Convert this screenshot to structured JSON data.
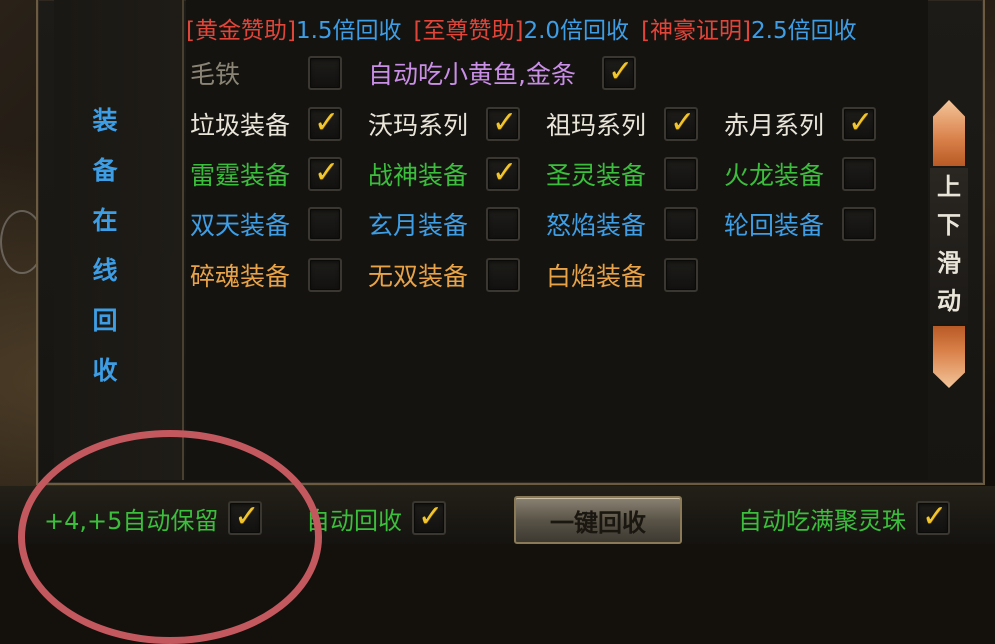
{
  "sponsors": [
    {
      "tag": "[黄金赞助]",
      "value": "1.5倍回收"
    },
    {
      "tag": "[至尊赞助]",
      "value": "2.0倍回收"
    },
    {
      "tag": "[神豪证明]",
      "value": "2.5倍回收"
    }
  ],
  "side_title": "装\n备\n在\n线\n回\n收",
  "row0": [
    {
      "label": "毛铁",
      "checked": false,
      "color": "#8a8474"
    },
    {
      "label": "自动吃小黄鱼,金条",
      "checked": true,
      "color": "#c98ee6"
    }
  ],
  "rows": [
    [
      {
        "label": "垃圾装备",
        "checked": true,
        "color": "#e9e5d9"
      },
      {
        "label": "沃玛系列",
        "checked": true,
        "color": "#e9e5d9"
      },
      {
        "label": "祖玛系列",
        "checked": true,
        "color": "#e9e5d9"
      },
      {
        "label": "赤月系列",
        "checked": true,
        "color": "#e9e5d9"
      }
    ],
    [
      {
        "label": "雷霆装备",
        "checked": true,
        "color": "#3bbe3c"
      },
      {
        "label": "战神装备",
        "checked": true,
        "color": "#3bbe3c"
      },
      {
        "label": "圣灵装备",
        "checked": false,
        "color": "#3bbe3c"
      },
      {
        "label": "火龙装备",
        "checked": false,
        "color": "#3bbe3c"
      }
    ],
    [
      {
        "label": "双天装备",
        "checked": false,
        "color": "#3d9ee6"
      },
      {
        "label": "玄月装备",
        "checked": false,
        "color": "#3d9ee6"
      },
      {
        "label": "怒焰装备",
        "checked": false,
        "color": "#3d9ee6"
      },
      {
        "label": "轮回装备",
        "checked": false,
        "color": "#3d9ee6"
      }
    ],
    [
      {
        "label": "碎魂装备",
        "checked": false,
        "color": "#e8a348"
      },
      {
        "label": "无双装备",
        "checked": false,
        "color": "#e8a348"
      },
      {
        "label": "白焰装备",
        "checked": false,
        "color": "#e8a348"
      }
    ]
  ],
  "scroll_label": "上\n下\n滑\n动",
  "bottom": {
    "keep_label": "+4,+5自动保留",
    "keep_checked": true,
    "auto_recycle_label": "自动回收",
    "auto_recycle_checked": true,
    "one_key_label": "一键回收",
    "auto_eat_label": "自动吃满聚灵珠",
    "auto_eat_checked": true
  },
  "check_glyph": "✓"
}
